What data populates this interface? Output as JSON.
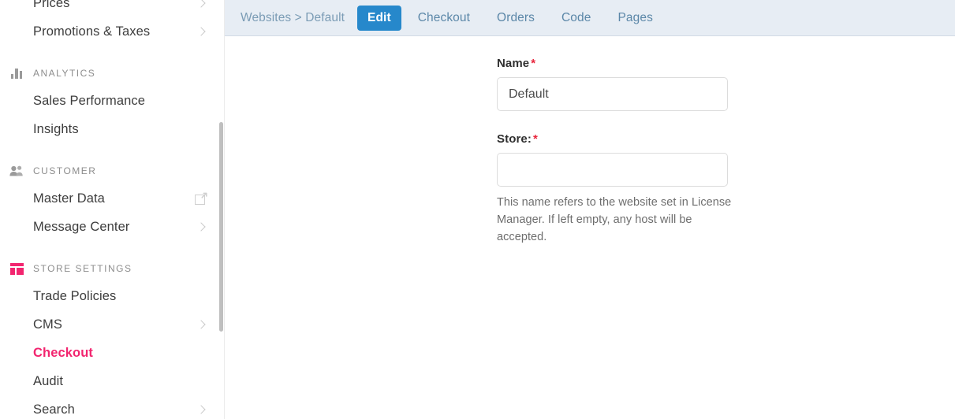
{
  "sidebar": {
    "items": [
      {
        "label": "Prices",
        "icon": "chevron-right-icon",
        "trailing": "chevron",
        "active": false,
        "kind": "item"
      },
      {
        "label": "Promotions & Taxes",
        "trailing": "chevron",
        "active": false,
        "kind": "item"
      }
    ],
    "groups": [
      {
        "title": "ANALYTICS",
        "icon": "bar-chart-icon",
        "icon_color": "#9a9a9a",
        "items": [
          {
            "label": "Sales Performance",
            "trailing": "none",
            "active": false
          },
          {
            "label": "Insights",
            "trailing": "none",
            "active": false
          }
        ]
      },
      {
        "title": "CUSTOMER",
        "icon": "people-icon",
        "icon_color": "#9a9a9a",
        "items": [
          {
            "label": "Master Data",
            "trailing": "external-link",
            "active": false
          },
          {
            "label": "Message Center",
            "trailing": "chevron",
            "active": false
          }
        ]
      },
      {
        "title": "STORE SETTINGS",
        "icon": "layout-grid-icon",
        "icon_color": "#f2256f",
        "items": [
          {
            "label": "Trade Policies",
            "trailing": "none",
            "active": false
          },
          {
            "label": "CMS",
            "trailing": "chevron",
            "active": false
          },
          {
            "label": "Checkout",
            "trailing": "none",
            "active": true
          },
          {
            "label": "Audit",
            "trailing": "none",
            "active": false
          },
          {
            "label": "Search",
            "trailing": "chevron",
            "active": false
          }
        ]
      }
    ],
    "active_color": "#f2256f"
  },
  "topbar": {
    "breadcrumb": "Websites > Default",
    "tabs": [
      {
        "label": "Edit",
        "active": true
      },
      {
        "label": "Checkout",
        "active": false
      },
      {
        "label": "Orders",
        "active": false
      },
      {
        "label": "Code",
        "active": false
      },
      {
        "label": "Pages",
        "active": false
      }
    ],
    "active_tab_color": "#2688cb",
    "background": "#e7edf4"
  },
  "form": {
    "fields": [
      {
        "label": "Name",
        "required_marker": "*",
        "value": "Default",
        "placeholder": "",
        "help": ""
      },
      {
        "label": "Store:",
        "required_marker": "*",
        "value": "",
        "placeholder": "",
        "help": "This name refers to the website set in License Manager. If left empty, any host will be accepted."
      }
    ],
    "required_color": "#e8243b"
  }
}
